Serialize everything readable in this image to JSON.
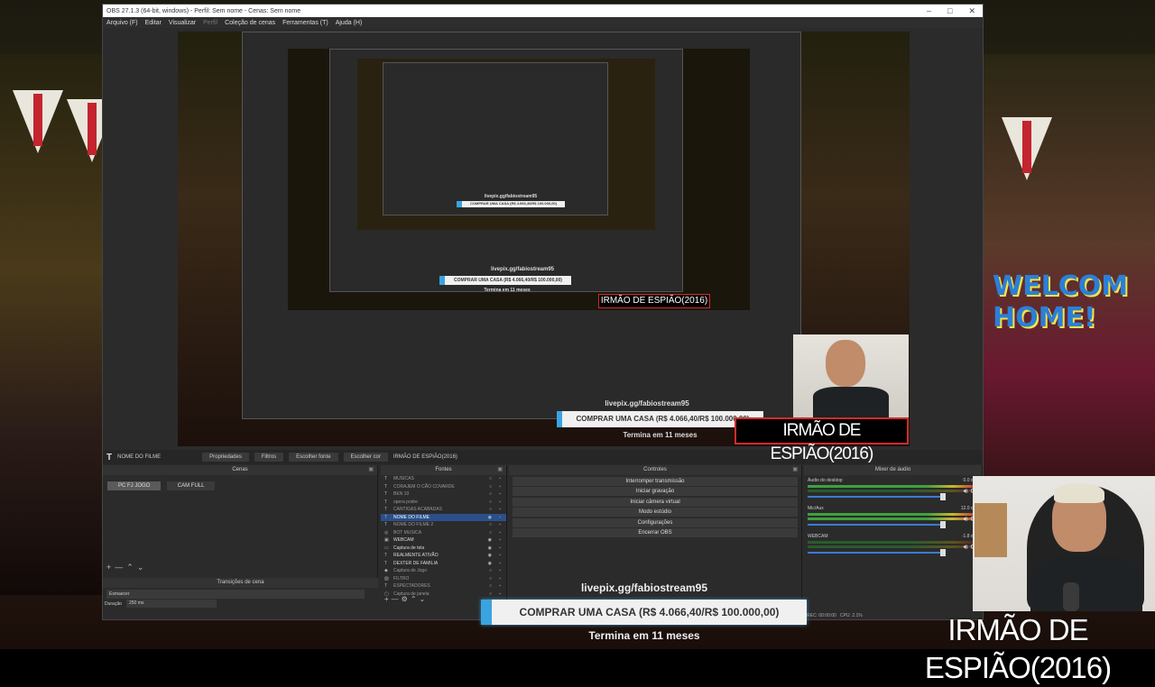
{
  "window": {
    "title": "OBS 27.1.3 (64-bit, windows) - Perfil: Sem nome - Cenas: Sem nome",
    "controls": [
      "–",
      "□",
      "✕"
    ]
  },
  "menu": {
    "items": [
      "Arquivo (F)",
      "Editar",
      "Visualizar",
      "Perfil",
      "Coleção de cenas",
      "Ferramentas (T)",
      "Ajuda (H)"
    ]
  },
  "toolbar": {
    "source_name": "NOME DO FILME",
    "properties": "Propriedades",
    "filters": "Filtros",
    "choose_source": "Escolher fonte",
    "choose_color": "Escolher cor",
    "text_value": "IRMÃO DE ESPIÃO(2016)"
  },
  "scenes": {
    "title": "Cenas",
    "items": [
      "PC FJ JOGO",
      "CAM FULL"
    ],
    "active": "PC FJ JOGO"
  },
  "sources": {
    "title": "Fontes",
    "items": [
      {
        "label": "MUSICAS",
        "icon": "text-icon",
        "visible": false
      },
      {
        "label": "CORAJEM O CÃO COVARDE",
        "icon": "text-icon",
        "visible": false
      },
      {
        "label": "BEN 10",
        "icon": "text-icon",
        "visible": false
      },
      {
        "label": "opera podre",
        "icon": "text-icon",
        "visible": false
      },
      {
        "label": "CANTIGAS ACABADAS",
        "icon": "text-icon",
        "visible": false
      },
      {
        "label": "NOME DO FILME",
        "icon": "text-icon",
        "visible": true,
        "active": true
      },
      {
        "label": "NOME DO FILME 2",
        "icon": "text-icon",
        "visible": false
      },
      {
        "label": "BOT MUSICA",
        "icon": "browser-icon",
        "visible": false
      },
      {
        "label": "WEBCAM",
        "icon": "camera-icon",
        "visible": true
      },
      {
        "label": "Captura de tela",
        "icon": "monitor-icon",
        "visible": true
      },
      {
        "label": "REALMENTE ATIVÃO",
        "icon": "text-icon",
        "visible": true
      },
      {
        "label": "DEXTER DE FAMILIA",
        "icon": "text-icon",
        "visible": true
      },
      {
        "label": "Captura de Jogo",
        "icon": "gamepad-icon",
        "visible": false
      },
      {
        "label": "FILTRO",
        "icon": "image-icon",
        "visible": false
      },
      {
        "label": "ESPECTADORES",
        "icon": "text-icon",
        "visible": false
      },
      {
        "label": "Captura de janela",
        "icon": "window-icon",
        "visible": false
      }
    ]
  },
  "controls": {
    "title": "Controles",
    "buttons": [
      "Interromper transmissão",
      "Iniciar gravação",
      "Iniciar câmera virtual",
      "Modo estúdio",
      "Configurações",
      "Encerrar OBS"
    ]
  },
  "mixer": {
    "title": "Mixer de áudio",
    "tracks": [
      {
        "name": "Áudio do desktop",
        "db": "0.0 dB"
      },
      {
        "name": "Mic/Aux",
        "db": "12.0 dB"
      },
      {
        "name": "WEBCAM",
        "db": "-1.8 dB"
      }
    ]
  },
  "transitions": {
    "title": "Transições de cena",
    "type": "Esmaecer",
    "duration_label": "Duração",
    "duration": "250 ms"
  },
  "status": {
    "text": "REC: 00:00:00",
    "cpu": "CPU: 2.1%"
  },
  "overlay": {
    "livepix": "livepix.gg/fabiostream95",
    "goal": "COMPRAR UMA CASA (R$ 4.066,40/R$ 100.000,00)",
    "ends": "Termina em 11 meses",
    "movie_title": "IRMÃO DE ESPIÃO(2016)",
    "goal_progress": 0.0407,
    "accent": "#3ba3e0"
  },
  "preview": {
    "livepix": "livepix.gg/fabiostream95",
    "goal": "COMPRAR UMA CASA (R$ 4.066,40/R$ 100.000,00)",
    "ends": "Termina em 11 meses",
    "movie_title": "IRMÃO DE ESPIÃO(2016)"
  }
}
